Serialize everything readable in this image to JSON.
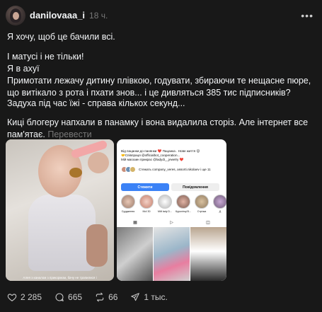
{
  "post": {
    "username": "danilovaaa_i",
    "time": "18 ч.",
    "more": "•••",
    "p1": "Я хочу, щоб це бачили всі.",
    "p2_lines": [
      "І матусі і не тільки!",
      "Я в ахуї",
      "Примотати лежачу дитину плівкою, годувати, збираючи те нещасне пюре, що витікало з рота і пхати знов... і це дивляться 385 тис підписників?"
    ],
    "p3": "Задуха під час їжі - справа кількох секунд...",
    "p4": "Киці блогеру напхали в панамку і вона видалила сторіз. Але інтернет все пам'ятає.",
    "translate": "Перевести"
  },
  "media_left": {
    "caption": "Алея з каналом з прикормом, бачу не трапилися і"
  },
  "media_right": {
    "bio_line1": "Від пацанки до панянки ❤️ Пацанка . Нове життя 😊",
    "bio_line2": "🤝Співпраця @officialbot_cooperation...",
    "bio_line3": "Мій магазин прикрас @ladydi__jewelry ❤️",
    "followers_text": "Стежать company_veres, assorti.nikolaev і ще 11",
    "follow_btn": "Стежити",
    "message_btn": "Повідомлення",
    "highlights": [
      "Суудження",
      "Мої 30",
      "Мій lady D...",
      "Куролінці В...",
      "Стрічка",
      "Д"
    ]
  },
  "actions": {
    "likes": "2 285",
    "comments": "665",
    "reposts": "66",
    "shares": "1 тыс."
  }
}
